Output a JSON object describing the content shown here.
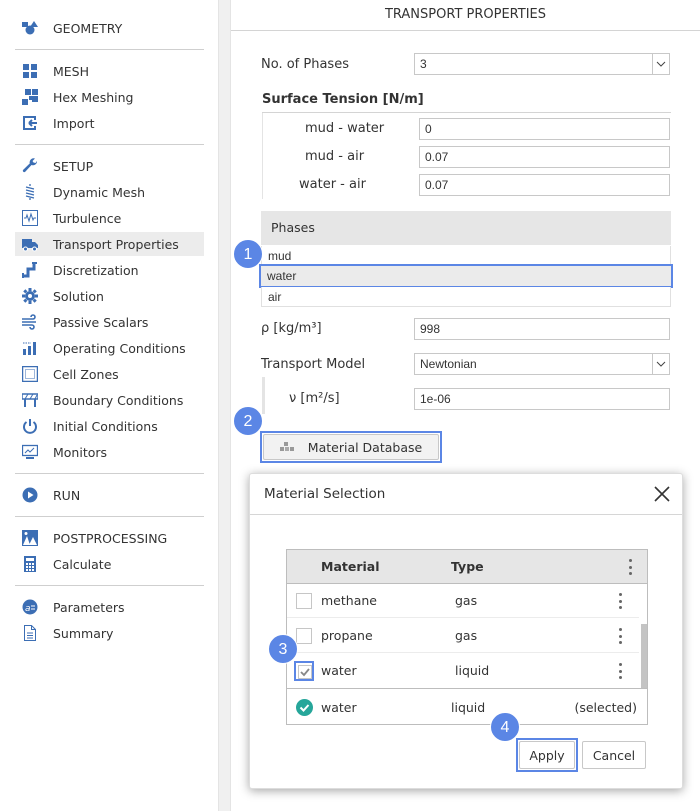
{
  "sidebar": {
    "items": [
      {
        "label": "GEOMETRY",
        "icon": "geometry-icon"
      },
      {
        "label": "MESH",
        "icon": "mesh-icon"
      },
      {
        "label": "Hex Meshing",
        "icon": "hex-meshing-icon"
      },
      {
        "label": "Import",
        "icon": "import-icon"
      },
      {
        "label": "SETUP",
        "icon": "wrench-icon"
      },
      {
        "label": "Dynamic Mesh",
        "icon": "spring-icon"
      },
      {
        "label": "Turbulence",
        "icon": "waveform-icon"
      },
      {
        "label": "Transport Properties",
        "icon": "truck-icon",
        "active": true
      },
      {
        "label": "Discretization",
        "icon": "pipe-icon"
      },
      {
        "label": "Solution",
        "icon": "gear-icon"
      },
      {
        "label": "Passive Scalars",
        "icon": "wind-icon"
      },
      {
        "label": "Operating Conditions",
        "icon": "bar-chart-icon"
      },
      {
        "label": "Cell Zones",
        "icon": "cell-zones-icon"
      },
      {
        "label": "Boundary Conditions",
        "icon": "barrier-icon"
      },
      {
        "label": "Initial Conditions",
        "icon": "power-icon"
      },
      {
        "label": "Monitors",
        "icon": "monitor-icon"
      },
      {
        "label": "RUN",
        "icon": "play-icon"
      },
      {
        "label": "POSTPROCESSING",
        "icon": "image-icon"
      },
      {
        "label": "Calculate",
        "icon": "calculator-icon"
      },
      {
        "label": "Parameters",
        "icon": "parameters-icon"
      },
      {
        "label": "Summary",
        "icon": "document-icon"
      }
    ]
  },
  "main": {
    "title": "TRANSPORT PROPERTIES",
    "phases_count": {
      "label": "No. of Phases",
      "value": "3"
    },
    "surface_tension": {
      "heading": "Surface Tension [N/m]",
      "rows": [
        {
          "label": "mud - water",
          "value": "0"
        },
        {
          "label": "mud - air",
          "value": "0.07"
        },
        {
          "label": "water - air",
          "value": "0.07"
        }
      ]
    },
    "phases": {
      "heading": "Phases",
      "items": [
        "mud",
        "water",
        "air"
      ],
      "selected": "water"
    },
    "density": {
      "label": "ρ [kg/m³]",
      "value": "998"
    },
    "transport_model": {
      "label": "Transport Model",
      "value": "Newtonian"
    },
    "viscosity": {
      "label": "ν [m²/s]",
      "value": "1e-06"
    },
    "material_db_button": "Material Database"
  },
  "dialog": {
    "title": "Material Selection",
    "columns": {
      "material": "Material",
      "type": "Type"
    },
    "rows": [
      {
        "material": "methane",
        "type": "gas",
        "checked": false
      },
      {
        "material": "propane",
        "type": "gas",
        "checked": false
      },
      {
        "material": "water",
        "type": "liquid",
        "checked": true
      }
    ],
    "selected": {
      "material": "water",
      "type": "liquid",
      "status": "(selected)"
    },
    "apply_label": "Apply",
    "cancel_label": "Cancel"
  },
  "steps": [
    "1",
    "2",
    "3",
    "4"
  ],
  "colors": {
    "accent": "#5b86e5",
    "icon_blue": "#3c6eb4",
    "selected_check": "#26a69a"
  }
}
